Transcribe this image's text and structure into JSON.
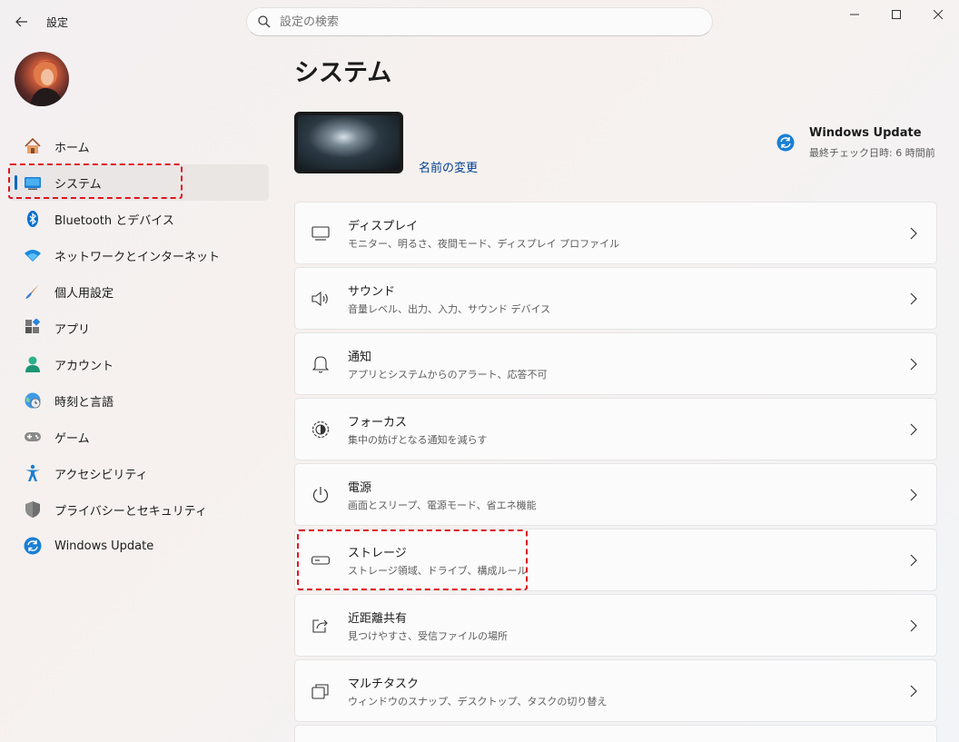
{
  "window": {
    "title": "設定"
  },
  "search": {
    "placeholder": "設定の検索"
  },
  "sidebar": {
    "items": [
      {
        "label": "ホーム",
        "icon": "home-icon"
      },
      {
        "label": "システム",
        "icon": "system-display-icon",
        "selected": true
      },
      {
        "label": "Bluetooth とデバイス",
        "icon": "bluetooth-icon"
      },
      {
        "label": "ネットワークとインターネット",
        "icon": "wifi-icon"
      },
      {
        "label": "個人用設定",
        "icon": "brush-icon"
      },
      {
        "label": "アプリ",
        "icon": "apps-icon"
      },
      {
        "label": "アカウント",
        "icon": "account-icon"
      },
      {
        "label": "時刻と言語",
        "icon": "globe-clock-icon"
      },
      {
        "label": "ゲーム",
        "icon": "gamepad-icon"
      },
      {
        "label": "アクセシビリティ",
        "icon": "accessibility-icon"
      },
      {
        "label": "プライバシーとセキュリティ",
        "icon": "shield-icon"
      },
      {
        "label": "Windows Update",
        "icon": "windows-update-icon"
      }
    ]
  },
  "main": {
    "title": "システム",
    "rename_link": "名前の変更",
    "windows_update": {
      "title": "Windows Update",
      "subtitle": "最終チェック日時: 6 時間前"
    },
    "cards": [
      {
        "title": "ディスプレイ",
        "subtitle": "モニター、明るさ、夜間モード、ディスプレイ プロファイル",
        "icon": "monitor-icon"
      },
      {
        "title": "サウンド",
        "subtitle": "音量レベル、出力、入力、サウンド デバイス",
        "icon": "speaker-icon"
      },
      {
        "title": "通知",
        "subtitle": "アプリとシステムからのアラート、応答不可",
        "icon": "bell-icon"
      },
      {
        "title": "フォーカス",
        "subtitle": "集中の妨げとなる通知を減らす",
        "icon": "focus-icon"
      },
      {
        "title": "電源",
        "subtitle": "画面とスリープ、電源モード、省エネ機能",
        "icon": "power-icon"
      },
      {
        "title": "ストレージ",
        "subtitle": "ストレージ領域、ドライブ、構成ルール",
        "icon": "storage-drive-icon"
      },
      {
        "title": "近距離共有",
        "subtitle": "見つけやすさ、受信ファイルの場所",
        "icon": "share-icon"
      },
      {
        "title": "マルチタスク",
        "subtitle": "ウィンドウのスナップ、デスクトップ、タスクの切り替え",
        "icon": "multitask-icon"
      }
    ]
  },
  "colors": {
    "accent": "#0067c0",
    "highlight": "#e0141e",
    "link": "#003e92"
  }
}
